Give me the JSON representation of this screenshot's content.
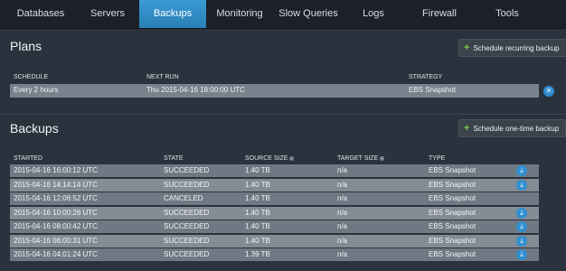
{
  "nav": {
    "tabs": [
      "Databases",
      "Servers",
      "Backups",
      "Monitoring",
      "Slow Queries",
      "Logs",
      "Firewall",
      "Tools"
    ],
    "active": "Backups"
  },
  "plans": {
    "title": "Plans",
    "schedule_button": "Schedule recurring backup",
    "headers": {
      "schedule": "SCHEDULE",
      "next_run": "NEXT RUN",
      "strategy": "STRATEGY"
    },
    "rows": [
      {
        "schedule": "Every 2 hours",
        "next_run": "Thu 2015-04-16 18:00:00 UTC",
        "strategy": "EBS Snapshot"
      }
    ]
  },
  "backups": {
    "title": "Backups",
    "schedule_button": "Schedule one-time backup",
    "headers": {
      "started": "STARTED",
      "state": "STATE",
      "source_size": "SOURCE SIZE",
      "target_size": "TARGET SIZE",
      "type": "TYPE"
    },
    "rows": [
      {
        "started": "2015-04-16 16:00:12 UTC",
        "state": "SUCCEEDED",
        "source_size": "1.40 TB",
        "target_size": "n/a",
        "type": "EBS Snapshot",
        "download": true
      },
      {
        "started": "2015-04-16 14:14:14 UTC",
        "state": "SUCCEEDED",
        "source_size": "1.40 TB",
        "target_size": "n/a",
        "type": "EBS Snapshot",
        "download": true
      },
      {
        "started": "2015-04-16 12:06:52 UTC",
        "state": "CANCELED",
        "source_size": "1.40 TB",
        "target_size": "n/a",
        "type": "EBS Snapshot",
        "download": false
      },
      {
        "started": "2015-04-16 10:00:26 UTC",
        "state": "SUCCEEDED",
        "source_size": "1.40 TB",
        "target_size": "n/a",
        "type": "EBS Snapshot",
        "download": true
      },
      {
        "started": "2015-04-16 08:00:42 UTC",
        "state": "SUCCEEDED",
        "source_size": "1.40 TB",
        "target_size": "n/a",
        "type": "EBS Snapshot",
        "download": true
      },
      {
        "started": "2015-04-16 06:00:31 UTC",
        "state": "SUCCEEDED",
        "source_size": "1.40 TB",
        "target_size": "n/a",
        "type": "EBS Snapshot",
        "download": true
      },
      {
        "started": "2015-04-16 04:01:24 UTC",
        "state": "SUCCEEDED",
        "source_size": "1.39 TB",
        "target_size": "n/a",
        "type": "EBS Snapshot",
        "download": true
      }
    ]
  },
  "colors": {
    "accent": "#2f8fcf",
    "plus": "#7ccf4b",
    "background": "#2a323d"
  }
}
